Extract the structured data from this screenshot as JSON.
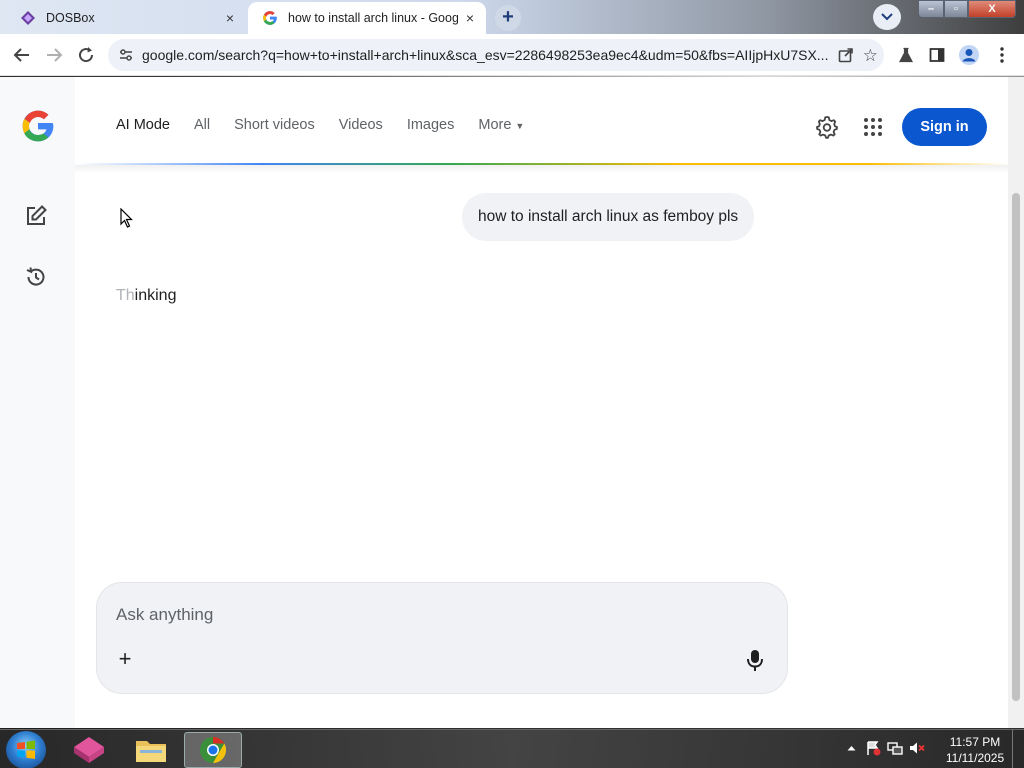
{
  "tabs": [
    {
      "title": "DOSBox",
      "close": "×"
    },
    {
      "title": "how to install arch linux - Google",
      "close": "×"
    }
  ],
  "new_tab_label": "+",
  "window_controls": {
    "minimize": "–",
    "maximize": "▫",
    "close": "X"
  },
  "address_bar": {
    "url": "google.com/search?q=how+to+install+arch+linux&sca_esv=2286498253ea9ec4&udm=50&fbs=AIIjpHxU7SX...",
    "star": "☆"
  },
  "google": {
    "nav": {
      "items": [
        "AI Mode",
        "All",
        "Short videos",
        "Videos",
        "Images",
        "More"
      ],
      "more_caret": "▼"
    },
    "sign_in": "Sign in"
  },
  "conversation": {
    "query": "how to install arch linux as femboy pls",
    "thinking_dim": "Th",
    "thinking_rest": "inking"
  },
  "ask_box": {
    "placeholder": "Ask anything",
    "plus": "+"
  },
  "taskbar": {
    "time": "11:57 PM",
    "date": "11/11/2025"
  },
  "colors": {
    "sign_in_bg": "#0b57d0",
    "google_blue": "#4285f4",
    "google_red": "#ea4335",
    "google_yellow": "#fbbc04",
    "google_green": "#34a853"
  }
}
